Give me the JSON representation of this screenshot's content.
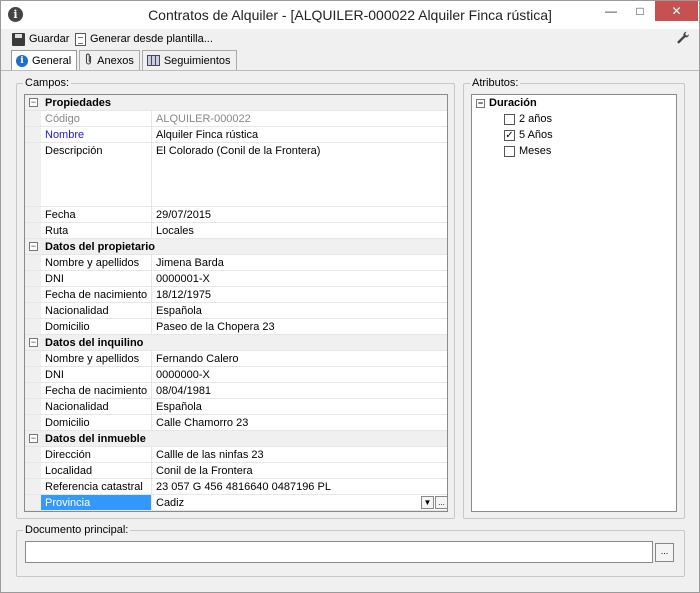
{
  "window": {
    "title": "Contratos de Alquiler - [ALQUILER-000022 Alquiler Finca  rústica]",
    "min_glyph": "—",
    "max_glyph": "□",
    "close_glyph": "✕"
  },
  "toolbar": {
    "save_label": "Guardar",
    "template_label": "Generar desde plantilla..."
  },
  "tabs": [
    {
      "label": "General",
      "icon": "info-icon",
      "active": true
    },
    {
      "label": "Anexos",
      "icon": "paperclip-icon",
      "active": false
    },
    {
      "label": "Seguimientos",
      "icon": "calendar-icon",
      "active": false
    }
  ],
  "campos": {
    "title": "Campos:",
    "categories": {
      "propiedades": "Propiedades",
      "propietario": "Datos del propietario",
      "inquilino": "Datos del inquilino",
      "inmueble": "Datos del inmueble"
    },
    "fields": {
      "codigo": {
        "label": "Código",
        "value": "ALQUILER-000022"
      },
      "nombre": {
        "label": "Nombre",
        "value": "Alquiler Finca  rústica"
      },
      "descripcion": {
        "label": "Descripción",
        "value": "El Colorado (Conil de la Frontera)"
      },
      "fecha": {
        "label": "Fecha",
        "value": "29/07/2015"
      },
      "ruta": {
        "label": "Ruta",
        "value": "Locales"
      },
      "prop_nombre": {
        "label": "Nombre y apellidos",
        "value": "Jimena Barda"
      },
      "prop_dni": {
        "label": "DNI",
        "value": "0000001-X"
      },
      "prop_fnac": {
        "label": "Fecha de nacimiento",
        "value": "18/12/1975"
      },
      "prop_nac": {
        "label": "Nacionalidad",
        "value": "Española"
      },
      "prop_dom": {
        "label": "Domicilio",
        "value": "Paseo de la Chopera 23"
      },
      "inq_nombre": {
        "label": "Nombre y apellidos",
        "value": "Fernando Calero"
      },
      "inq_dni": {
        "label": "DNI",
        "value": "0000000-X"
      },
      "inq_fnac": {
        "label": "Fecha de nacimiento",
        "value": "08/04/1981"
      },
      "inq_nac": {
        "label": "Nacionalidad",
        "value": "Española"
      },
      "inq_dom": {
        "label": "Domicilio",
        "value": "Calle Chamorro 23"
      },
      "direccion": {
        "label": "Dirección",
        "value": "Callle de las ninfas 23"
      },
      "localidad": {
        "label": "Localidad",
        "value": "Conil de la Frontera"
      },
      "ref_catastral": {
        "label": "Referencia catastral",
        "value": "23 057 G 456 4816640 0487196 PL"
      },
      "provincia": {
        "label": "Provincia",
        "value": "Cadiz"
      }
    },
    "dropdown_glyph": "▼",
    "ellipsis_glyph": "...",
    "collapse_glyph": "−"
  },
  "atributos": {
    "title": "Atributos:",
    "root": "Duración",
    "options": [
      {
        "label": "2 años",
        "checked": false
      },
      {
        "label": "5 Años",
        "checked": true
      },
      {
        "label": "Meses",
        "checked": false
      }
    ],
    "check_glyph": "✓"
  },
  "documento": {
    "title": "Documento principal:",
    "value": "",
    "button_glyph": "..."
  }
}
